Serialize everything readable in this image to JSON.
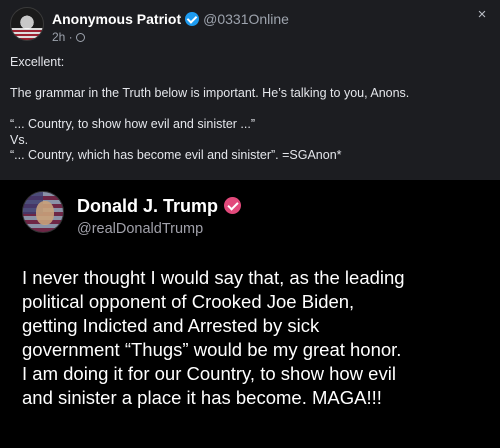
{
  "post": {
    "author_name": "Anonymous Patriot",
    "author_handle": "@0331Online",
    "time_ago": "2h ·",
    "icons": {
      "avatar": "skull-flag-avatar",
      "verified": "verified-check-icon",
      "globe": "globe-icon",
      "close": "close-icon"
    },
    "body_lines": [
      "Excellent:",
      "",
      "The grammar in the Truth below is important. He’s talking to you, Anons.",
      "",
      "“... Country, to show how evil and sinister ...”",
      "Vs.",
      "“... Country, which has become evil and sinister”. =SGAnon*"
    ]
  },
  "embedded_truth": {
    "name": "Donald J. Trump",
    "handle": "@realDonaldTrump",
    "text_lines": [
      "I never thought I would say that, as the leading",
      "political opponent of Crooked Joe Biden,",
      "getting Indicted and Arrested by sick",
      "government “Thugs” would be my great honor.",
      "I am doing it for our Country, to show how evil",
      "and sinister a place it has become. MAGA!!!"
    ],
    "badge_color": "#e2497b"
  },
  "colors": {
    "background": "#1c1d21",
    "accent_blue": "#1d9bf0",
    "truth_background": "#000000"
  }
}
